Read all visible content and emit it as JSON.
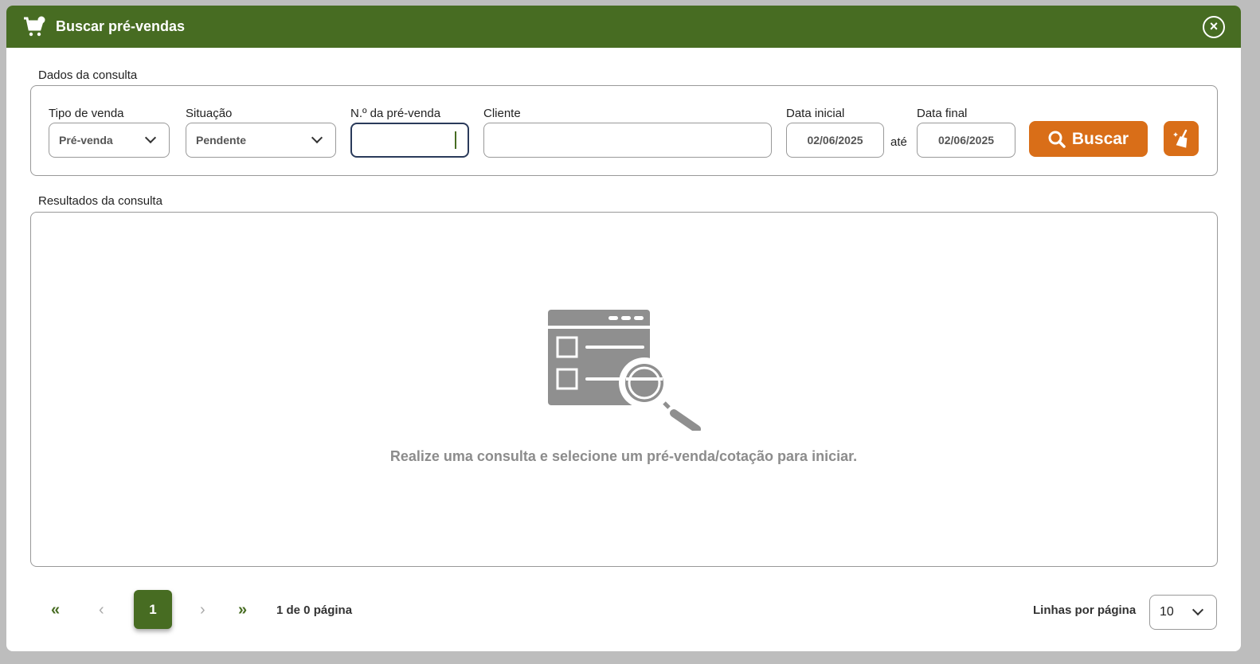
{
  "modal": {
    "title": "Buscar pré-vendas",
    "icon": "cart-icon",
    "close_icon": "close-circle-icon"
  },
  "query": {
    "section_label": "Dados da consulta",
    "tipo_venda": {
      "label": "Tipo de venda",
      "value": "Pré-venda"
    },
    "situacao": {
      "label": "Situação",
      "value": "Pendente"
    },
    "numero": {
      "label": "N.º da pré-venda",
      "value": ""
    },
    "cliente": {
      "label": "Cliente",
      "value": ""
    },
    "data_inicial": {
      "label": "Data inicial",
      "value": "02/06/2025"
    },
    "ate": "até",
    "data_final": {
      "label": "Data final",
      "value": "02/06/2025"
    },
    "buscar_label": "Buscar",
    "clear_icon": "broom-icon"
  },
  "results": {
    "section_label": "Resultados da consulta",
    "empty_message": "Realize uma consulta e selecione um pré-venda/cotação para iniciar."
  },
  "pagination": {
    "current_page": "1",
    "info": "1 de 0 página",
    "rows_label": "Linhas por página",
    "rows_value": "10"
  },
  "colors": {
    "header": "#476c22",
    "accent": "#d96e18"
  }
}
